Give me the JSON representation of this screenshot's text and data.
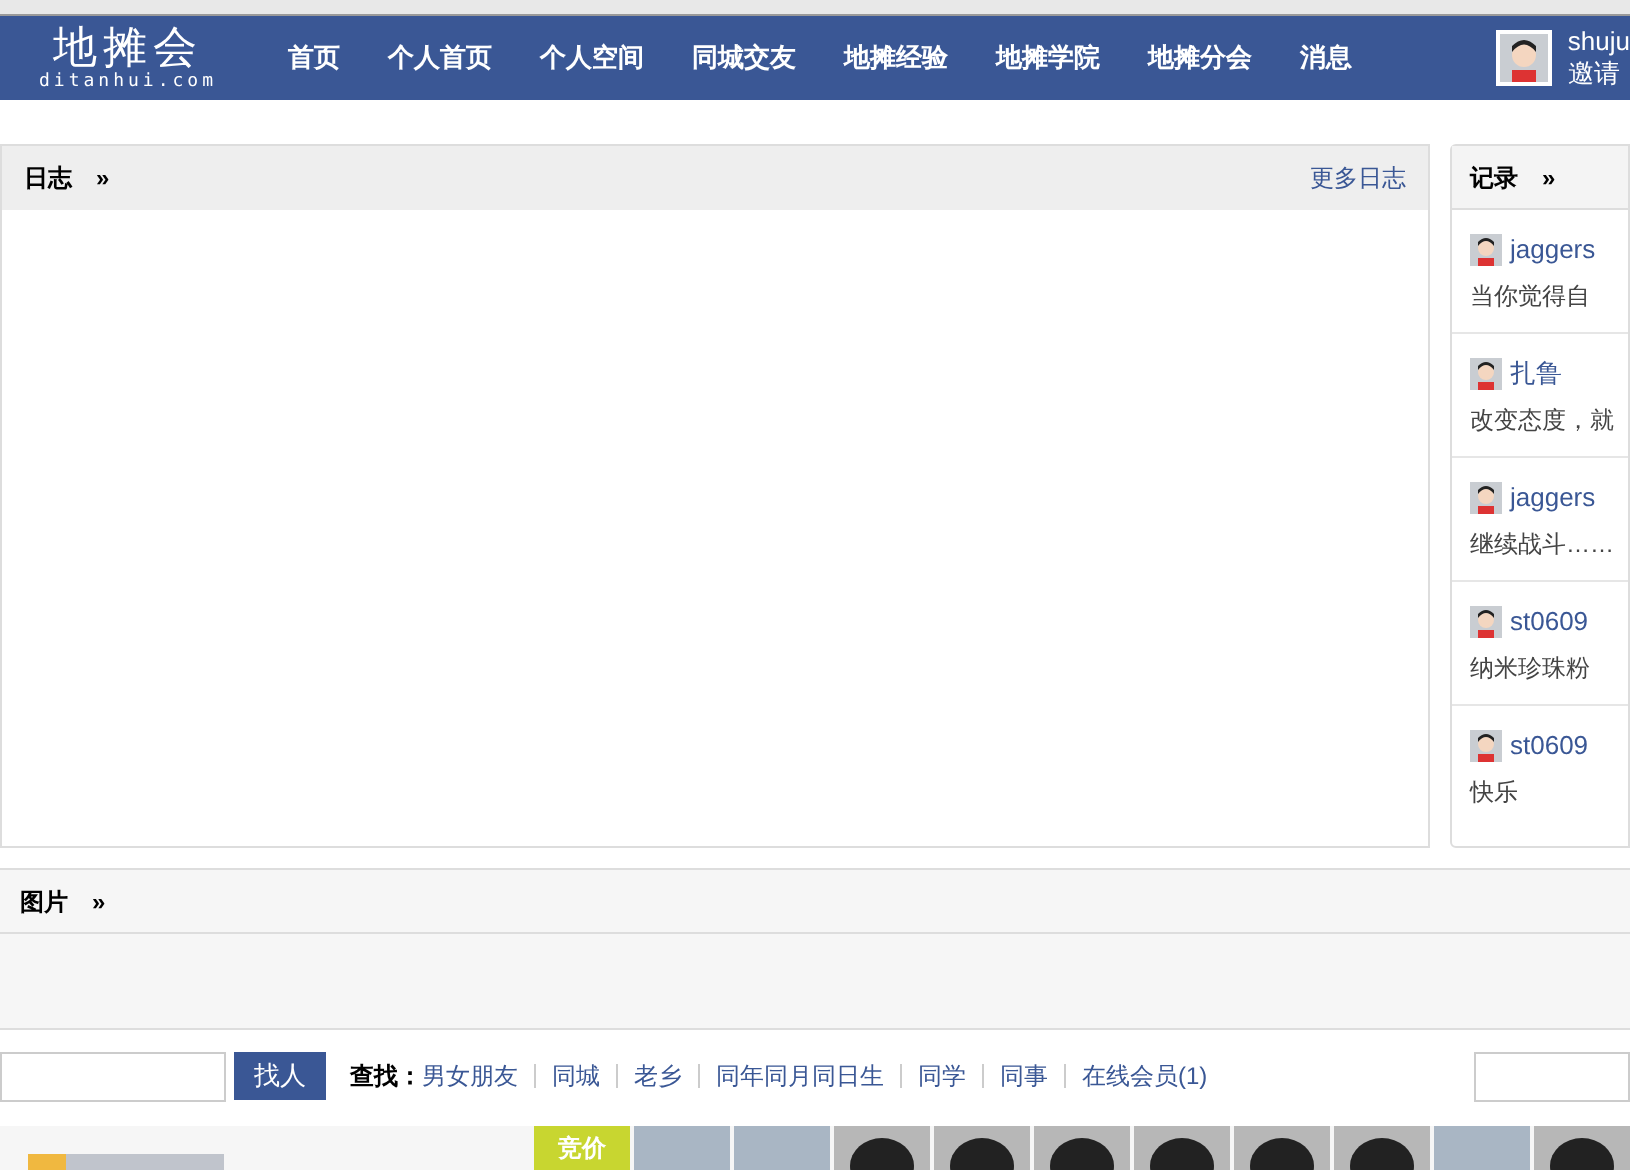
{
  "logo": {
    "title": "地摊会",
    "domain": "ditanhui.com"
  },
  "nav": [
    {
      "label": "首页"
    },
    {
      "label": "个人首页"
    },
    {
      "label": "个人空间"
    },
    {
      "label": "同城交友"
    },
    {
      "label": "地摊经验"
    },
    {
      "label": "地摊学院"
    },
    {
      "label": "地摊分会"
    },
    {
      "label": "消息"
    }
  ],
  "user": {
    "name": "shuju",
    "invite": "邀请"
  },
  "journal": {
    "title": "日志",
    "arrow": "»",
    "more": "更多日志"
  },
  "records": {
    "title": "记录",
    "arrow": "»",
    "items": [
      {
        "name": "jaggers",
        "text": "当你觉得自"
      },
      {
        "name": "扎鲁",
        "text": "改变态度，就"
      },
      {
        "name": "jaggers",
        "text": "继续战斗……"
      },
      {
        "name": "st0609",
        "text": "纳米珍珠粉"
      },
      {
        "name": "st0609",
        "text": "快乐"
      }
    ]
  },
  "pictures": {
    "title": "图片",
    "arrow": "»"
  },
  "search": {
    "button": "找人",
    "label": "查找：",
    "links": [
      {
        "label": "男女朋友"
      },
      {
        "label": "同城"
      },
      {
        "label": "老乡"
      },
      {
        "label": "同年同月同日生"
      },
      {
        "label": "同学"
      },
      {
        "label": "同事"
      },
      {
        "label": "在线会员(1)"
      }
    ]
  },
  "bidding": {
    "tag": "竞价",
    "thumbs": [
      {
        "kind": "photo"
      },
      {
        "kind": "photo"
      },
      {
        "kind": "avatar"
      },
      {
        "kind": "avatar"
      },
      {
        "kind": "avatar"
      },
      {
        "kind": "avatar"
      },
      {
        "kind": "avatar"
      },
      {
        "kind": "avatar"
      },
      {
        "kind": "photo"
      },
      {
        "kind": "avatar"
      }
    ]
  }
}
